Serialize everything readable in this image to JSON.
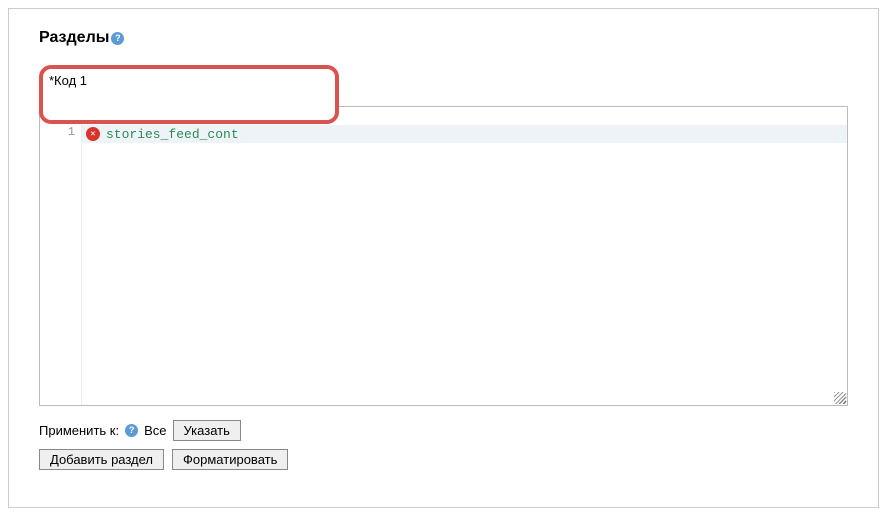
{
  "heading": "Разделы",
  "codeSection": {
    "label": "*Код 1",
    "lineNumber": "1",
    "content": "stories_feed_cont"
  },
  "applyRow": {
    "label": "Применить к:",
    "allText": "Все",
    "specifyButton": "Указать"
  },
  "buttons": {
    "addSection": "Добавить раздел",
    "format": "Форматировать"
  }
}
